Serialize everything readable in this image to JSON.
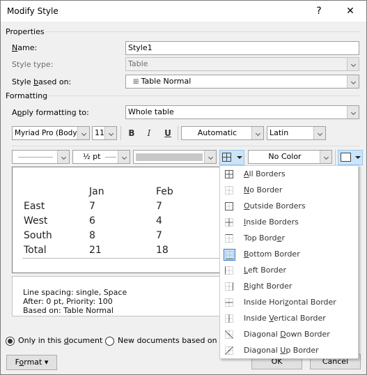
{
  "window": {
    "title": "Modify Style",
    "help_label": "?",
    "close_label": "✕"
  },
  "properties": {
    "group_label": "Properties",
    "name_label_pre": "",
    "name_label_u": "N",
    "name_label_post": "ame:",
    "name_value": "Style1",
    "style_type_label": "Style type:",
    "style_type_value": "Table",
    "based_on_label_pre": "Style ",
    "based_on_label_u": "b",
    "based_on_label_post": "ased on:",
    "based_on_value": "Table Normal"
  },
  "formatting": {
    "group_label": "Formatting",
    "apply_label_pre": "A",
    "apply_label_u": "p",
    "apply_label_post": "ply formatting to:",
    "apply_value": "Whole table",
    "font_value": "Myriad Pro (Body)",
    "size_value": "11",
    "bold_label": "B",
    "italic_label": "I",
    "underline_label": "U",
    "color_value": "Automatic",
    "script_value": "Latin",
    "line_weight_value": "½ pt",
    "shading_value": "No Color"
  },
  "preview": {
    "columns": [
      "",
      "Jan",
      "Feb"
    ],
    "rows": [
      [
        "East",
        "7",
        "7"
      ],
      [
        "West",
        "6",
        "4"
      ],
      [
        "South",
        "8",
        "7"
      ],
      [
        "Total",
        "21",
        "18"
      ]
    ]
  },
  "description": [
    "Line spacing:  single, Space",
    "After:  0 pt, Priority: 100",
    "Based on: Table Normal"
  ],
  "options": {
    "only_doc_pre": "Only in this ",
    "only_doc_u": "d",
    "only_doc_post": "ocument",
    "new_docs": "New documents based on th",
    "only_doc_selected": true
  },
  "buttons": {
    "format_pre": "F",
    "format_u": "o",
    "format_post": "rmat ▾",
    "ok": "OK",
    "cancel": "Cancel"
  },
  "border_menu": {
    "items": [
      {
        "pre": "",
        "u": "A",
        "post": "ll Borders",
        "icon": "all-borders"
      },
      {
        "pre": "",
        "u": "N",
        "post": "o Border",
        "icon": "no-border"
      },
      {
        "pre": "",
        "u": "O",
        "post": "utside Borders",
        "icon": "outside-borders"
      },
      {
        "pre": "",
        "u": "I",
        "post": "nside Borders",
        "icon": "inside-borders"
      },
      {
        "pre": "Top Bord",
        "u": "e",
        "post": "r",
        "icon": "top-border"
      },
      {
        "pre": "",
        "u": "B",
        "post": "ottom Border",
        "icon": "bottom-border",
        "selected": true
      },
      {
        "pre": "",
        "u": "L",
        "post": "eft Border",
        "icon": "left-border"
      },
      {
        "pre": "",
        "u": "R",
        "post": "ight Border",
        "icon": "right-border"
      },
      {
        "pre": "Inside Hori",
        "u": "z",
        "post": "ontal Border",
        "icon": "inside-horizontal-border"
      },
      {
        "pre": "Inside ",
        "u": "V",
        "post": "ertical Border",
        "icon": "inside-vertical-border"
      },
      {
        "pre": "Diagonal ",
        "u": "D",
        "post": "own Border",
        "icon": "diagonal-down-border"
      },
      {
        "pre": "Diagonal ",
        "u": "U",
        "post": "p Border",
        "icon": "diagonal-up-border"
      }
    ]
  }
}
